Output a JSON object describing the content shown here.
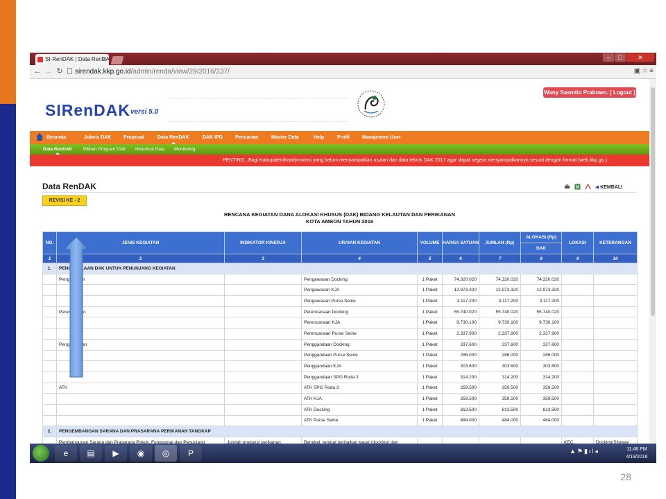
{
  "slide": {
    "number": "28"
  },
  "browser": {
    "tab_title": "SI-RenDAK | Data RenDAK",
    "url_host": "sirendak.kkp.go.id",
    "url_path": "/admin/renda/view/29/2016/237/"
  },
  "header": {
    "user_label": "Wany Sasmito Prabowo. [ Logout ]",
    "logo": "SIRenDAK",
    "logo_versi": "versi 5.0"
  },
  "main_nav": [
    "Beranda",
    "Juknis DAK",
    "Proposal",
    "Data RenDAK",
    "DAK IPD",
    "Pencarian",
    "Master Data",
    "Help",
    "Profil",
    "Manajemen User"
  ],
  "sub_nav": [
    "Data RenDAK",
    "Pilihan Program DAK",
    "Historical Data",
    "Monitoring"
  ],
  "ticker": "PENTING...Bagi Kabupaten/kota/provinsi yang belum menyampaikan usulan dan data teknis DAK 2017 agar dapat segera menyampaikannya sesuai dengan format (web.kkp.go.)",
  "page": {
    "title": "Data RenDAK",
    "kembali": "KEMBALI",
    "revisi": "REVISI KE - 2",
    "report_title_1": "RENCANA KEGIATAN DANA ALOKASI KHUSUS (DAK) BIDANG KELAUTAN DAN PERIKANAN",
    "report_title_2": "KOTA AMBON TAHUN 2016"
  },
  "table": {
    "headers": {
      "no": "NO.",
      "jenis": "JENIS KEGIATAN",
      "indikator": "INDIKATOR KINERJA",
      "uraian": "URAIAN KEGIATAN",
      "volume": "VOLUME",
      "harga": "HARGA SATUAN",
      "jumlah": "JUMLAH (Rp)",
      "alokasi": "ALOKASI (Rp)",
      "dak": "DAK",
      "lokasi": "LOKASI",
      "keterangan": "KETERANGAN"
    },
    "col_numbers": [
      "1",
      "2",
      "3",
      "4",
      "5",
      "6",
      "7",
      "8",
      "9",
      "10"
    ],
    "section1": {
      "no": "1.",
      "title": "PENGELOLAAN DAK UNTUK PENUNJANG KEGIATAN"
    },
    "rows": [
      {
        "jenis": "Pengawasan",
        "uraian": "Pengawasan Docking",
        "volume": "1 Paket",
        "harga": "74.320.020",
        "jumlah": "74.320.020",
        "dak": "74.320.020"
      },
      {
        "jenis": "",
        "uraian": "Pengawasan KJA",
        "volume": "1 Paket",
        "harga": "12.973.320",
        "jumlah": "12.973.320",
        "dak": "12.973.320"
      },
      {
        "jenis": "",
        "uraian": "Pengawasan Purse Seine",
        "volume": "1 Paket",
        "harga": "3.117.200",
        "jumlah": "3.117.200",
        "dak": "3.117.200"
      },
      {
        "jenis": "Perencanaan",
        "uraian": "Perencanaan Docking",
        "volume": "1 Paket",
        "harga": "55.740.020",
        "jumlah": "55.740.020",
        "dak": "55.740.020"
      },
      {
        "jenis": "",
        "uraian": "Perencanaan KJA",
        "volume": "1 Paket",
        "harga": "9.730.100",
        "jumlah": "9.730.100",
        "dak": "9.730.100"
      },
      {
        "jenis": "",
        "uraian": "Perencanaan Purse Seine",
        "volume": "1 Paket",
        "harga": "2.337.900",
        "jumlah": "2.337.900",
        "dak": "2.337.900"
      },
      {
        "jenis": "Penggandaan",
        "uraian": "Penggandaan Docking",
        "volume": "1 Paket",
        "harga": "337.600",
        "jumlah": "337.600",
        "dak": "337.600"
      },
      {
        "jenis": "",
        "uraian": "Penggandaan Purse Seine",
        "volume": "1 Paket",
        "harga": "286.000",
        "jumlah": "286.000",
        "dak": "286.000"
      },
      {
        "jenis": "",
        "uraian": "Penggandaan KJA",
        "volume": "1 Paket",
        "harga": "303.600",
        "jumlah": "303.600",
        "dak": "303.600"
      },
      {
        "jenis": "",
        "uraian": "Penggandaan SPG Roda 3",
        "volume": "1 Paket",
        "harga": "314.200",
        "jumlah": "314.200",
        "dak": "314.200"
      },
      {
        "jenis": "ATK",
        "uraian": "ATK SPG Roda 3",
        "volume": "1 Paket",
        "harga": "359.500",
        "jumlah": "359.500",
        "dak": "359.500"
      },
      {
        "jenis": "",
        "uraian": "ATK KJA",
        "volume": "1 Paket",
        "harga": "359.500",
        "jumlah": "359.500",
        "dak": "359.500"
      },
      {
        "jenis": "",
        "uraian": "ATK Docking",
        "volume": "1 Paket",
        "harga": "813.500",
        "jumlah": "813.500",
        "dak": "813.500"
      },
      {
        "jenis": "",
        "uraian": "ATK Purse Seine",
        "volume": "1 Paket",
        "harga": "484.000",
        "jumlah": "484.000",
        "dak": "484.000"
      }
    ],
    "section2": {
      "no": "2.",
      "title": "PENGEMBANGAN SARANA DAN PRASARANA PERIKANAN TANGKAP"
    },
    "partial_row": {
      "jenis": "Pembangunan Sarana dan Prasarana Pokok, Fungsional dan Penunjang",
      "indikator": "Jumlah produksi perikanan",
      "uraian": "Bengkel, tempat perbaikan kapal (docking) dan",
      "lokasi": "KEC.",
      "keterangan": "Docking/Slipway"
    }
  },
  "taskbar": {
    "time": "11:46 PM",
    "date": "4/19/2016"
  },
  "colors": {
    "nav_orange": "#ee7b22",
    "subnav_green": "#6aab18",
    "ticker_red": "#ea3a2f",
    "table_header_blue": "#3d6fd0",
    "badge_yellow": "#f7d11e"
  }
}
